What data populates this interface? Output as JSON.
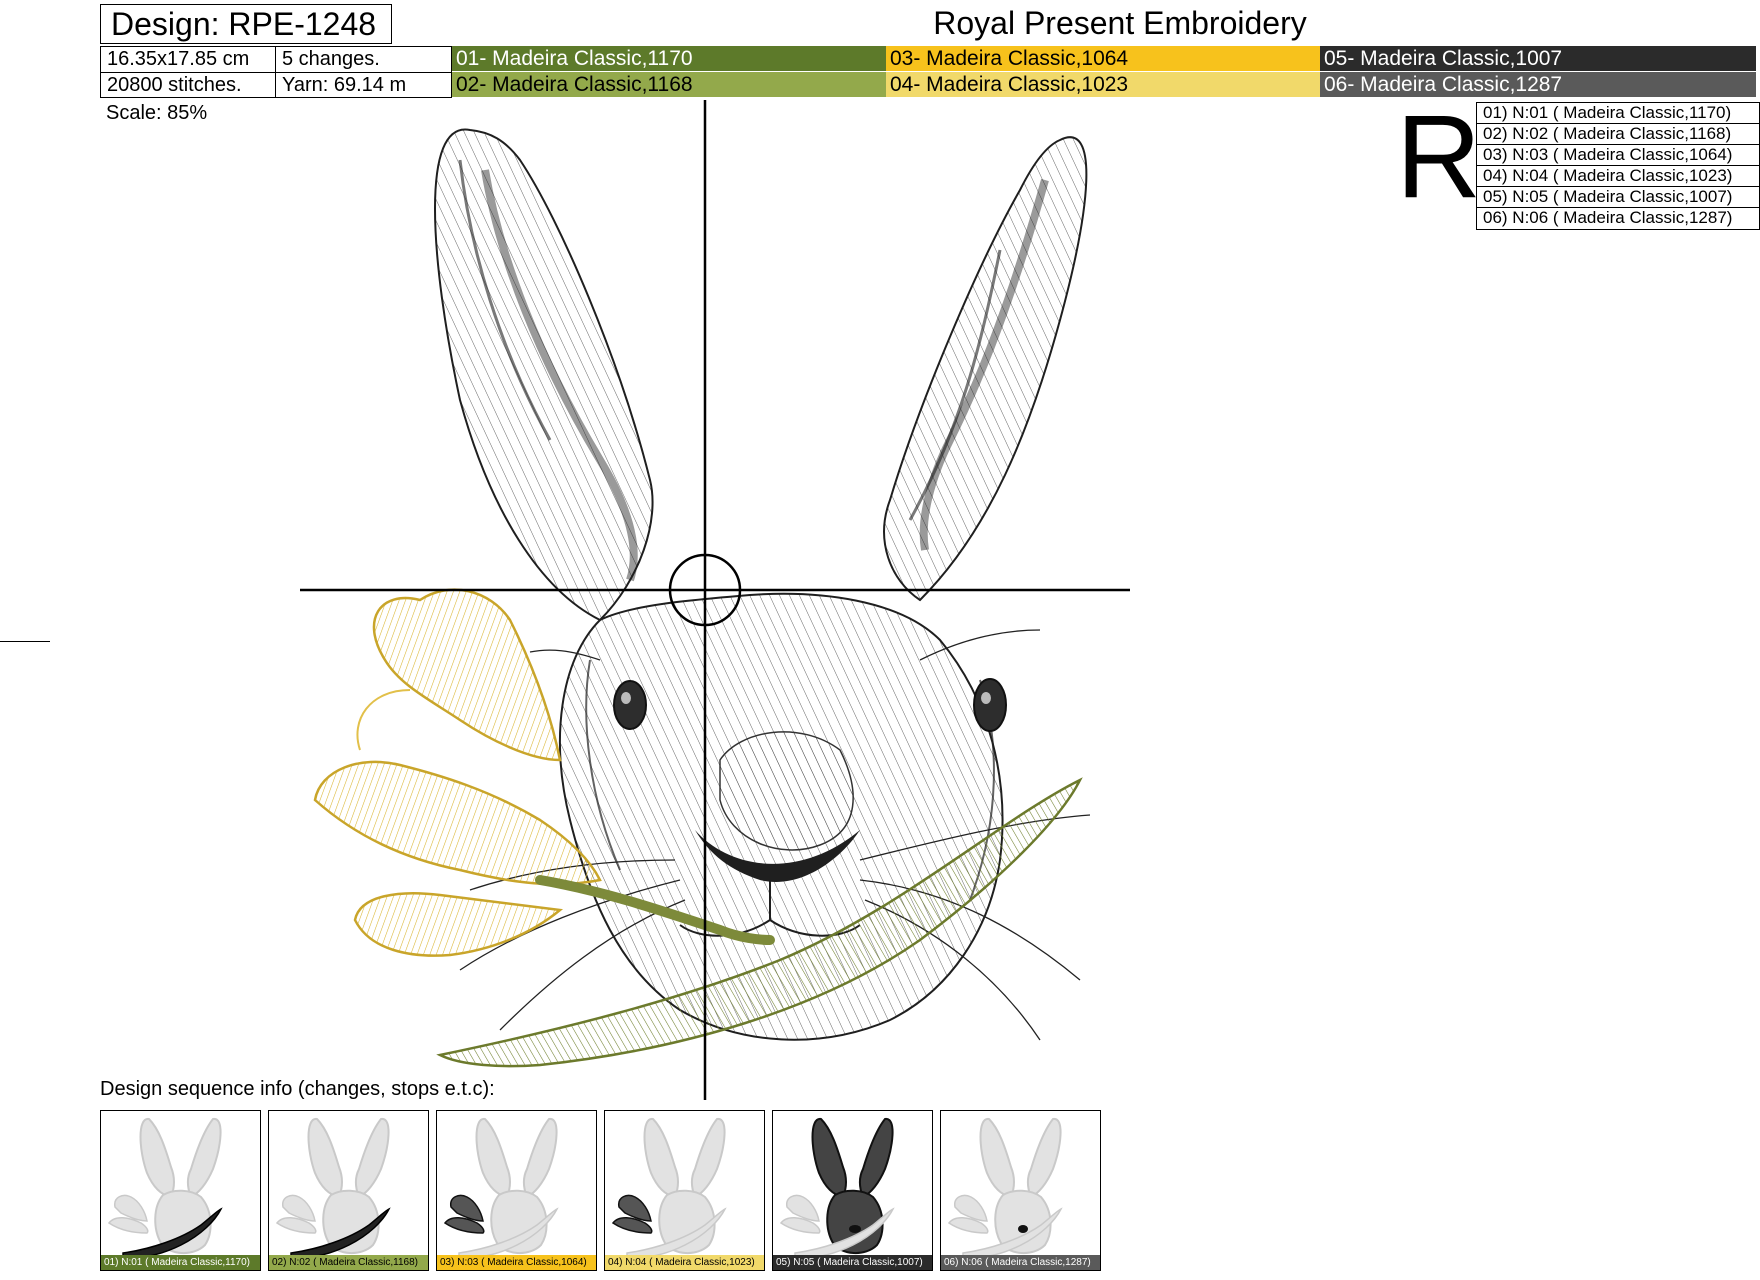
{
  "header": {
    "design_title": "Design: RPE-1248",
    "brand": "Royal Present Embroidery",
    "size": "16.35x17.85 cm",
    "changes": "5 changes.",
    "stitches": "20800 stitches.",
    "yarn": "Yarn: 69.14 m",
    "scale": "Scale: 85%"
  },
  "threads": [
    {
      "label": "01- Madeira Classic,1170",
      "color": "#5d7a2a",
      "text_color": "#ffffff"
    },
    {
      "label": "02- Madeira Classic,1168",
      "color": "#93a94b",
      "text_color": "#000000"
    },
    {
      "label": "03- Madeira Classic,1064",
      "color": "#f7c21c",
      "text_color": "#000000"
    },
    {
      "label": "04- Madeira Classic,1023",
      "color": "#f1d96a",
      "text_color": "#000000"
    },
    {
      "label": "05- Madeira Classic,1007",
      "color": "#2b2b2b",
      "text_color": "#ffffff"
    },
    {
      "label": "06- Madeira Classic,1287",
      "color": "#5a5a5a",
      "text_color": "#ffffff"
    }
  ],
  "legend": {
    "letter": "R",
    "items": [
      "01) N:01 ( Madeira Classic,1170)",
      "02) N:02 ( Madeira Classic,1168)",
      "03) N:03 ( Madeira Classic,1064)",
      "04) N:04 ( Madeira Classic,1023)",
      "05) N:05 ( Madeira Classic,1007)",
      "06) N:06 ( Madeira Classic,1287)"
    ]
  },
  "sequence": {
    "label": "Design sequence info (changes, stops e.t.c):",
    "thumbs": [
      {
        "caption": "01) N:01 ( Madeira Classic,1170)",
        "highlight": "leaf-dark"
      },
      {
        "caption": "02) N:02 ( Madeira Classic,1168)",
        "highlight": "leaf-light"
      },
      {
        "caption": "03) N:03 ( Madeira Classic,1064)",
        "highlight": "flower"
      },
      {
        "caption": "04) N:04 ( Madeira Classic,1023)",
        "highlight": "flower-light"
      },
      {
        "caption": "05) N:05 ( Madeira Classic,1007)",
        "highlight": "hare"
      },
      {
        "caption": "06) N:06 ( Madeira Classic,1287)",
        "highlight": "nose"
      }
    ]
  },
  "icons": {
    "centering_marker": "crosshair-circle-icon",
    "thumbnail_art": "hare-icon"
  }
}
